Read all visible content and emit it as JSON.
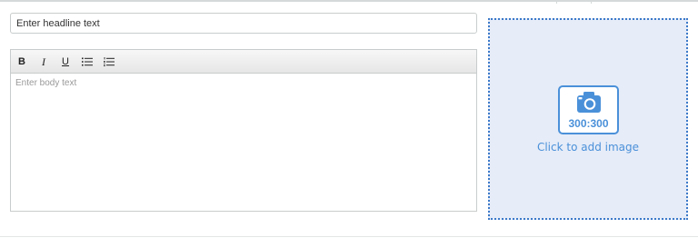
{
  "headline": {
    "placeholder": "Enter headline text"
  },
  "editor": {
    "toolbar": {
      "bold_label": "B",
      "italic_label": "I",
      "underline_label": "U",
      "bullets_icon": "bulleted-list-icon",
      "numbers_icon": "numbered-list-icon"
    },
    "body_placeholder": "Enter body text"
  },
  "image_upload": {
    "icon": "camera-icon",
    "ratio": "300:300",
    "label": "Click to add image"
  },
  "colors": {
    "accent": "#4a90d9",
    "dropzone_border": "#3b79c9",
    "dropzone_background": "#e6ecf8"
  }
}
